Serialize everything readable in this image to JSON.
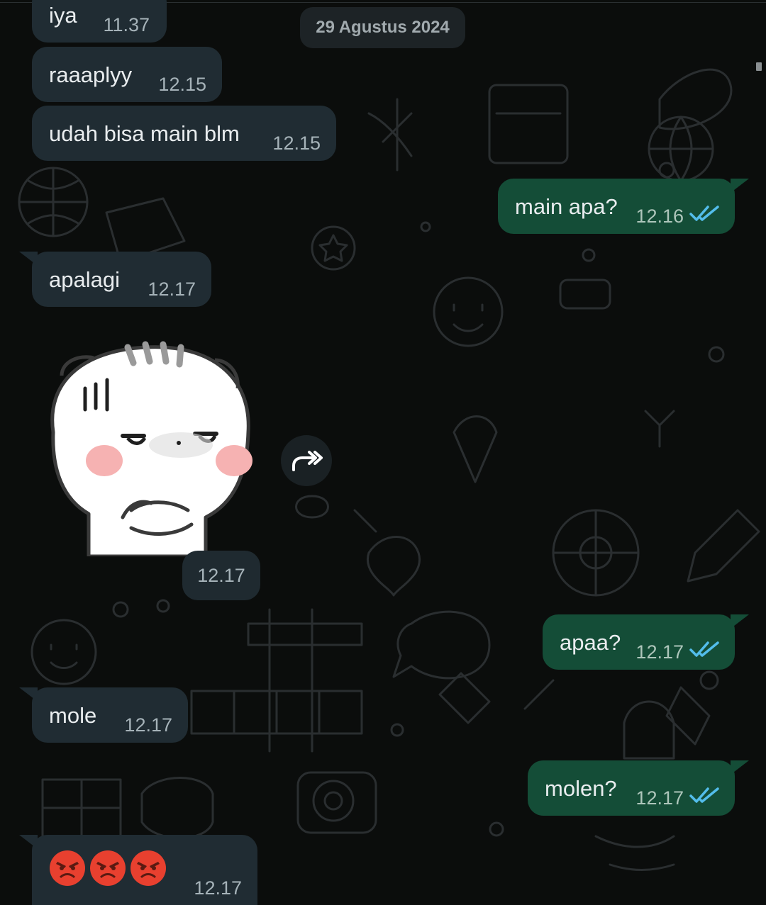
{
  "date_chip": "29 Agustus 2024",
  "messages": [
    {
      "dir": "in",
      "text": "iya",
      "time": "11.37"
    },
    {
      "dir": "in",
      "text": "raaaplyy",
      "time": "12.15"
    },
    {
      "dir": "in",
      "text": "udah bisa main blm",
      "time": "12.15"
    },
    {
      "dir": "out",
      "text": "main apa?",
      "time": "12.16",
      "status": "read"
    },
    {
      "dir": "in",
      "text": "apalagi",
      "time": "12.17"
    },
    {
      "dir": "in",
      "type": "sticker",
      "sticker": "grumpy-white-cat-sticker",
      "time": "12.17"
    },
    {
      "dir": "out",
      "text": "apaa?",
      "time": "12.17",
      "status": "read"
    },
    {
      "dir": "in",
      "text": "mole",
      "time": "12.17"
    },
    {
      "dir": "out",
      "text": "molen?",
      "time": "12.17",
      "status": "read"
    },
    {
      "dir": "in",
      "type": "emoji",
      "emoji": "😡😡😡",
      "emoji_icon": "angry-face-emoji",
      "time": "12.17"
    }
  ],
  "colors": {
    "background": "#0b0d0c",
    "incoming_bubble": "#202c33",
    "outgoing_bubble": "#144d37",
    "read_ticks": "#53bdeb",
    "timestamp": "#a6b3b9"
  },
  "icons": {
    "forward": "forward-icon",
    "read_receipt": "double-check-icon"
  }
}
